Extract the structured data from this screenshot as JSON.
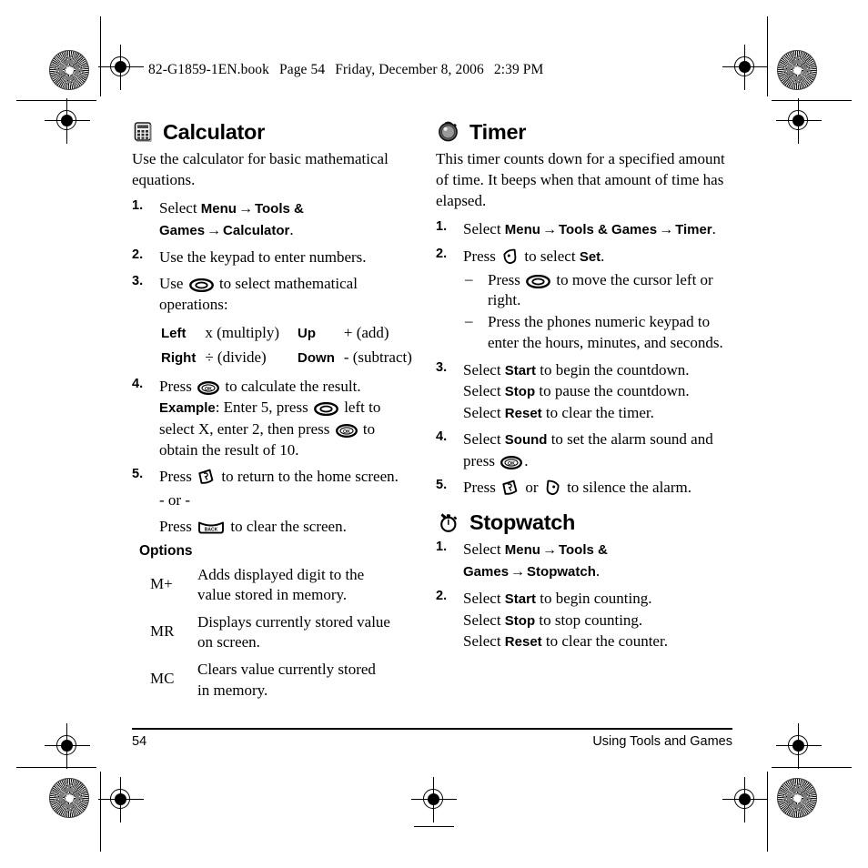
{
  "header": {
    "filename": "82-G1859-1EN.book",
    "page_label": "Page 54",
    "date": "Friday, December 8, 2006",
    "time": "2:39 PM"
  },
  "calculator": {
    "title": "Calculator",
    "icon": "calculator-icon",
    "intro": "Use the calculator for basic mathematical equations.",
    "steps": [
      {
        "num": "1.",
        "pre": "Select ",
        "ui1": "Menu",
        "ui2": "Tools & Games",
        "ui3": "Calculator",
        "post": "."
      },
      {
        "num": "2.",
        "text": "Use the keypad to enter numbers."
      },
      {
        "num": "3.",
        "pre": "Use ",
        "icon": "navigation-key-icon",
        "post": " to select mathematical operations:",
        "dirs": [
          {
            "key": "Left",
            "value": "x (multiply)"
          },
          {
            "key": "Up",
            "value": "+ (add)"
          },
          {
            "key": "Right",
            "value": "÷ (divide)"
          },
          {
            "key": "Down",
            "value": "- (subtract)"
          }
        ]
      },
      {
        "num": "4.",
        "p1": "Press ",
        "icon1": "ok-key-icon",
        "p2": " to calculate the result. ",
        "bold1": "Example",
        "p3": ": Enter 5, press ",
        "icon2": "navigation-key-icon",
        "p4": " left to select X, enter 2, then press ",
        "icon3": "ok-key-icon",
        "p5": " to obtain the result of 10."
      },
      {
        "num": "5.",
        "p1": "Press ",
        "icon1": "end-call-key-icon",
        "p2": " to return to the home screen.",
        "or": "- or -",
        "p3": "Press ",
        "icon2": "back-key-icon",
        "p4": " to clear the screen."
      }
    ],
    "options_heading": "Options",
    "options": [
      {
        "label": "M+",
        "description": "Adds displayed digit to the value stored in memory."
      },
      {
        "label": "MR",
        "description": "Displays currently stored value on screen."
      },
      {
        "label": "MC",
        "description": "Clears value currently stored in memory."
      }
    ]
  },
  "timer": {
    "title": "Timer",
    "icon": "timer-icon",
    "intro": "This timer counts down for a specified amount of time. It beeps when that amount of time has elapsed.",
    "steps": [
      {
        "num": "1.",
        "pre": "Select ",
        "ui1": "Menu",
        "ui2": "Tools & Games",
        "ui3": "Timer",
        "post": "."
      },
      {
        "num": "2.",
        "p1": "Press ",
        "icon1": "left-softkey-icon",
        "p2": " to select ",
        "bold1": "Set",
        "p3": ".",
        "sub": [
          {
            "dash": "–",
            "p1": "Press ",
            "icon": "navigation-key-icon",
            "p2": " to move the cursor left or right."
          },
          {
            "dash": "–",
            "p1": "Press the phones numeric keypad to enter the hours, minutes, and seconds."
          }
        ]
      },
      {
        "num": "3.",
        "lines": [
          {
            "pre": "Select ",
            "bold": "Start",
            "post": " to begin the countdown."
          },
          {
            "pre": "Select ",
            "bold": "Stop",
            "post": " to pause the countdown."
          },
          {
            "pre": "Select ",
            "bold": "Reset",
            "post": " to clear the timer."
          }
        ]
      },
      {
        "num": "4.",
        "p1": "Select ",
        "bold1": "Sound",
        "p2": " to set the alarm sound and press ",
        "icon1": "ok-key-icon",
        "p3": "."
      },
      {
        "num": "5.",
        "p1": "Press ",
        "icon1": "end-call-key-icon",
        "p2": " or ",
        "icon2": "right-softkey-icon",
        "p3": " to silence the alarm."
      }
    ]
  },
  "stopwatch": {
    "title": "Stopwatch",
    "icon": "stopwatch-icon",
    "steps": [
      {
        "num": "1.",
        "pre": "Select ",
        "ui1": "Menu",
        "ui2": "Tools & Games",
        "ui3": "Stopwatch",
        "post": "."
      },
      {
        "num": "2.",
        "lines": [
          {
            "pre": "Select ",
            "bold": "Start",
            "post": " to begin counting."
          },
          {
            "pre": "Select ",
            "bold": "Stop",
            "post": " to stop counting."
          },
          {
            "pre": "Select ",
            "bold": "Reset",
            "post": " to clear the counter."
          }
        ]
      }
    ]
  },
  "footer": {
    "page_number": "54",
    "section_title": "Using Tools and Games"
  },
  "arrow": "→"
}
